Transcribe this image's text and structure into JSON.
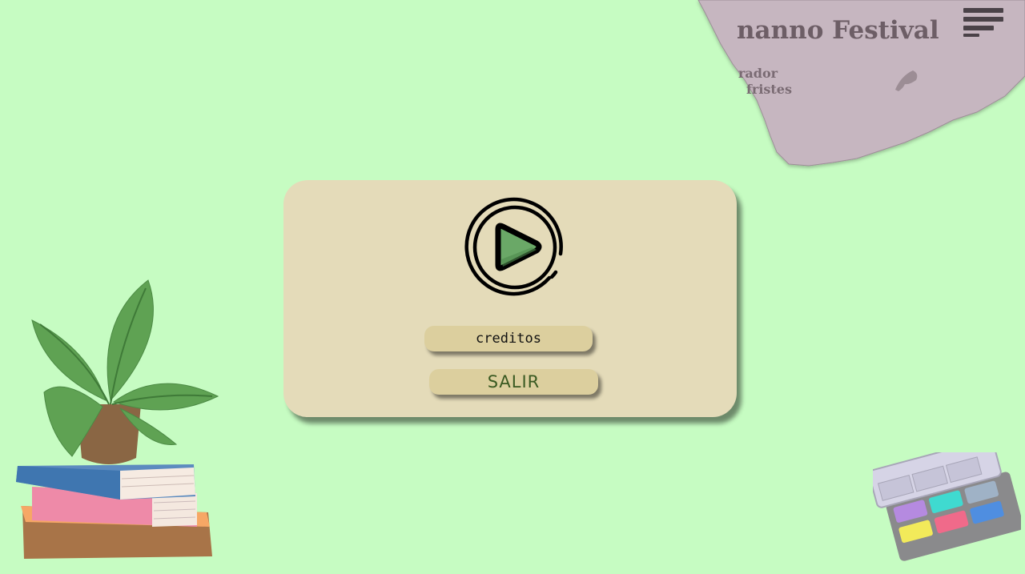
{
  "newspaper": {
    "headline": "nanno Festival",
    "line1": "rador",
    "line2": "fristes"
  },
  "menu": {
    "play_icon": "play-circle-icon",
    "creditos_label": "creditos",
    "salir_label": "SALIR"
  },
  "header": {
    "menu_icon": "hamburger-menu-icon"
  },
  "colors": {
    "background": "#c6fcc2",
    "card": "#e4dbb9",
    "button": "#dccf9e",
    "play_green": "#6aa867",
    "salir_text": "#3a5a22"
  }
}
